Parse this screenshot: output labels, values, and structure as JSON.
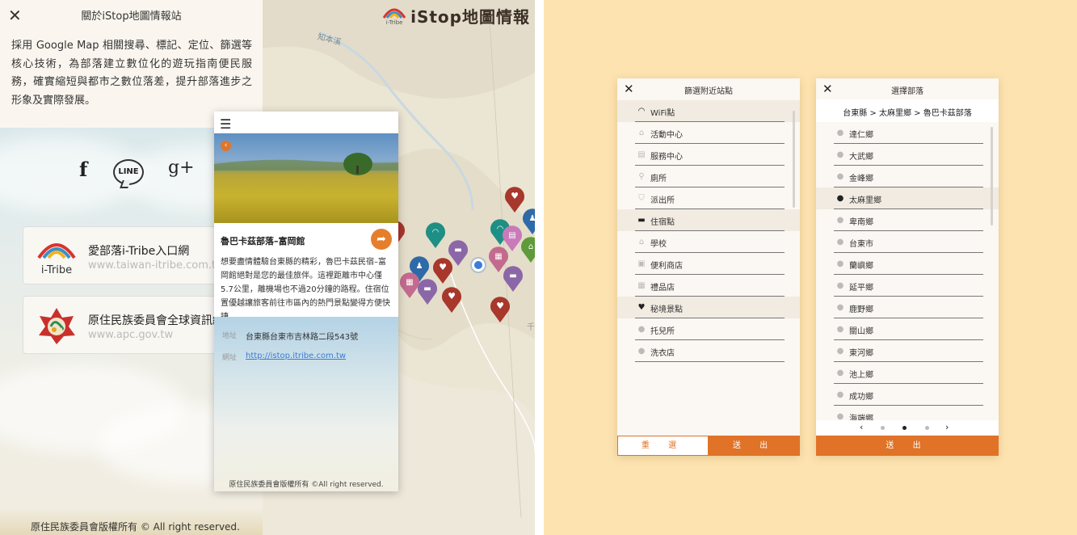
{
  "about": {
    "title": "關於iStop地圖情報站",
    "description": "採用 Google Map 相關搜尋、標記、定位、篩選等核心技術，為部落建立數位化的遊玩指南便民服務，確實縮短與都市之數位落差，提升部落進步之形象及實際發展。",
    "social": {
      "facebook": "f",
      "line": "LINE",
      "gplus": "g+"
    },
    "links": [
      {
        "name": "愛部落i-Tribe入口網",
        "url": "www.taiwan-itribe.com.tw",
        "logo_text": "i-Tribe"
      },
      {
        "name": "原住民族委員會全球資訊網",
        "url": "www.apc.gov.tw"
      }
    ],
    "footer": "原住民族委員會版權所有 © All right reserved."
  },
  "map": {
    "brand_name": "iStop地圖情報",
    "brand_logo_text": "i-Tribe",
    "river_label": "知本溪",
    "edge_mark": "千"
  },
  "detail": {
    "place_name": "魯巴卡茲部落–富岡館",
    "description": "想要盡情體驗台東縣的精彩，魯巴卡茲民宿–富岡館絕對是您的最佳旅伴。這裡距離市中心僅5.7公里，離機場也不過20分鐘的路程。住宿位置優越讓旅客前往市區內的熱門景點變得方便快捷。",
    "address_label": "地址",
    "address": "台東縣台東市吉林路二段543號",
    "website_label": "網址",
    "website": "http://istop.itribe.com.tw",
    "copyright": "原住民族委員會版權所有 ©All right reserved."
  },
  "filter": {
    "title": "篩選附近站點",
    "items": [
      {
        "label": "WiFi點",
        "icon": "wifi-icon",
        "glyph": "📶"
      },
      {
        "label": "活動中心",
        "icon": "house-icon",
        "glyph": "⌂"
      },
      {
        "label": "服務中心",
        "icon": "chat-icon",
        "glyph": "▤"
      },
      {
        "label": "廁所",
        "icon": "toilet-icon",
        "glyph": "♿"
      },
      {
        "label": "派出所",
        "icon": "shield-icon",
        "glyph": "⛊"
      },
      {
        "label": "住宿點",
        "icon": "bed-icon",
        "glyph": "▬"
      },
      {
        "label": "學校",
        "icon": "school-icon",
        "glyph": "⌂"
      },
      {
        "label": "便利商店",
        "icon": "store-icon",
        "glyph": "▣"
      },
      {
        "label": "禮品店",
        "icon": "gift-icon",
        "glyph": "▦"
      },
      {
        "label": "秘境景點",
        "icon": "heart-icon",
        "glyph": "♥"
      },
      {
        "label": "托兒所",
        "icon": "pin-icon",
        "glyph": "●"
      },
      {
        "label": "洗衣店",
        "icon": "pin-icon",
        "glyph": "●"
      }
    ],
    "reset_label": "重 選",
    "send_label": "送 出"
  },
  "tribe": {
    "title": "選擇部落",
    "breadcrumb": "台東縣 > 太麻里鄉 > 魯巴卡茲部落",
    "items": [
      "達仁鄉",
      "大武鄉",
      "金峰鄉",
      "太麻里鄉",
      "卑南鄉",
      "台東市",
      "蘭嶼鄉",
      "延平鄉",
      "鹿野鄉",
      "關山鄉",
      "東河鄉",
      "池上鄉",
      "成功鄉",
      "海端鄉"
    ],
    "selected": "太麻里鄉",
    "prev": "‹",
    "next": "›",
    "send_label": "送 出"
  },
  "colors": {
    "accent": "#e07327",
    "background": "#fde3b0"
  }
}
